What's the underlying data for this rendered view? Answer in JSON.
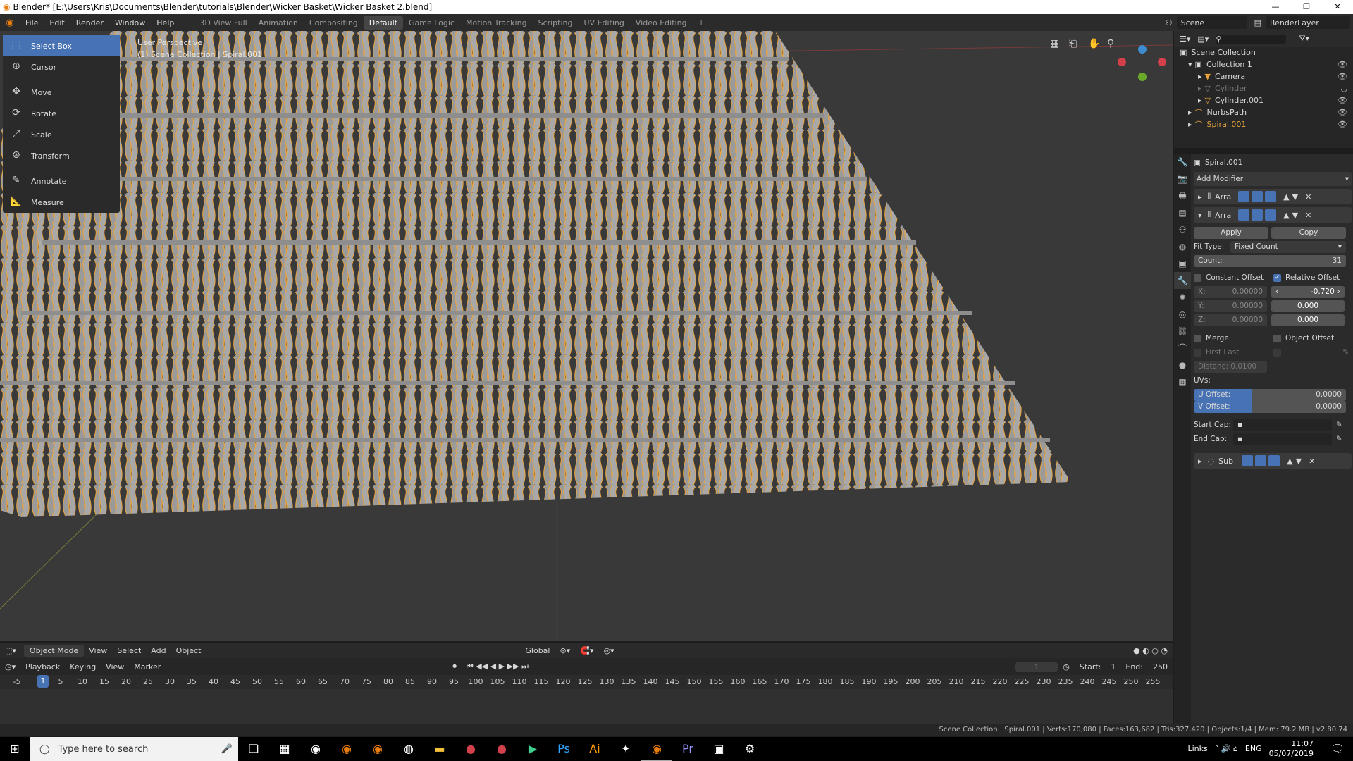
{
  "window_title": "Blender* [E:\\Users\\Kris\\Documents\\Blender\\tutorials\\Blender\\Wicker Basket\\Wicker Basket 2.blend]",
  "window_controls": [
    "—",
    "❐",
    "✕"
  ],
  "menu": [
    "File",
    "Edit",
    "Render",
    "Window",
    "Help"
  ],
  "workspaces": [
    "3D View Full",
    "Animation",
    "Compositing",
    "Default",
    "Game Logic",
    "Motion Tracking",
    "Scripting",
    "UV Editing",
    "Video Editing",
    "+"
  ],
  "active_workspace": "Default",
  "scene_name": "Scene",
  "view_layer": "RenderLayer",
  "tools": [
    "Select Box",
    "Cursor",
    "Move",
    "Rotate",
    "Scale",
    "Transform",
    "Annotate",
    "Measure"
  ],
  "viewport": {
    "perspective": "User Perspective",
    "collection_info": "(1) Scene Collection | Spiral.001"
  },
  "outliner": {
    "root": "Scene Collection",
    "items": [
      {
        "label": "Collection 1",
        "depth": 1
      },
      {
        "label": "Camera",
        "depth": 2
      },
      {
        "label": "Cylinder",
        "depth": 2
      },
      {
        "label": "Cylinder.001",
        "depth": 2
      },
      {
        "label": "NurbsPath",
        "depth": 1
      },
      {
        "label": "Spiral.001",
        "depth": 1
      }
    ]
  },
  "properties": {
    "object_name": "Spiral.001",
    "add_modifier": "Add Modifier",
    "mod1_name": "Arra",
    "mod2_name": "Arra",
    "apply": "Apply",
    "copy": "Copy",
    "fit_type_label": "Fit Type:",
    "fit_type_value": "Fixed Count",
    "count_label": "Count:",
    "count_value": "31",
    "constant_offset": "Constant Offset",
    "relative_offset": "Relative Offset",
    "const_x": "X:",
    "const_x_val": "0.00000",
    "const_y": "Y:",
    "const_y_val": "0.00000",
    "const_z": "Z:",
    "const_z_val": "0.00000",
    "rel_x_val": "-0.720",
    "rel_y_val": "0.000",
    "rel_z_val": "0.000",
    "merge": "Merge",
    "object_offset": "Object Offset",
    "first_last": "First Last",
    "distance": "Distanc: 0.0100",
    "uvs": "UVs:",
    "u_offset_label": "U Offset:",
    "u_offset_val": "0.0000",
    "v_offset_label": "V Offset:",
    "v_offset_val": "0.0000",
    "start_cap": "Start Cap:",
    "end_cap": "End Cap:",
    "mod3_name": "Sub"
  },
  "viewport_header": [
    "Object Mode",
    "View",
    "Select",
    "Add",
    "Object"
  ],
  "transform_orientation": "Global",
  "timeline_header": [
    "Playback",
    "Keying",
    "View",
    "Marker"
  ],
  "frame_current": "1",
  "frame_start_label": "Start:",
  "frame_start": "1",
  "frame_end_label": "End:",
  "frame_end": "250",
  "ruler_ticks": [
    "-5",
    "1",
    "5",
    "10",
    "15",
    "20",
    "25",
    "30",
    "35",
    "40",
    "45",
    "50",
    "55",
    "60",
    "65",
    "70",
    "75",
    "80",
    "85",
    "90",
    "95",
    "100",
    "105",
    "110",
    "115",
    "120",
    "125",
    "130",
    "135",
    "140",
    "145",
    "150",
    "155",
    "160",
    "165",
    "170",
    "175",
    "180",
    "185",
    "190",
    "195",
    "200",
    "205",
    "210",
    "215",
    "220",
    "225",
    "230",
    "235",
    "240",
    "245",
    "250",
    "255"
  ],
  "status": "Scene Collection | Spiral.001 | Verts:170,080 | Faces:163,682 | Tris:327,420 | Objects:1/4 | Mem: 79.2 MB | v2.80.74",
  "taskbar": {
    "search_placeholder": "Type here to search",
    "links": "Links",
    "lang": "ENG",
    "time": "11:07",
    "date": "05/07/2019"
  },
  "colors": {
    "accent": "#4772b3",
    "brand": "#e87d0d",
    "selection": "#e8a33d"
  }
}
